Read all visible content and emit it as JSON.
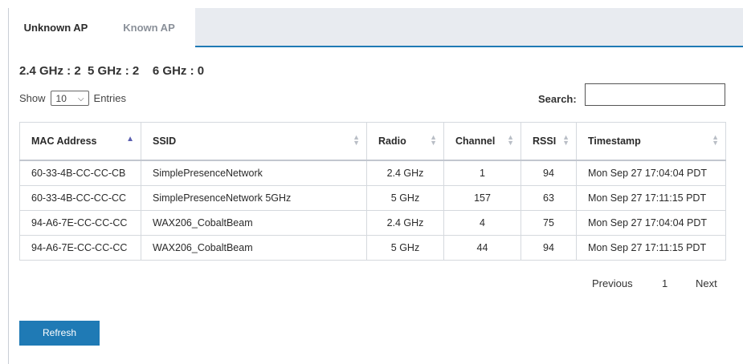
{
  "tabs": [
    {
      "label": "Unknown AP",
      "active": true
    },
    {
      "label": "Known AP",
      "active": false
    }
  ],
  "counts": {
    "g24": "2.4 GHz : 2",
    "g5": "5 GHz : 2",
    "g6": "6 GHz : 0"
  },
  "length_menu": {
    "show_label": "Show",
    "selected": "10",
    "entries_label": "Entries"
  },
  "search": {
    "label": "Search:",
    "value": ""
  },
  "table": {
    "columns": [
      "MAC Address",
      "SSID",
      "Radio",
      "Channel",
      "RSSI",
      "Timestamp"
    ],
    "rows": [
      [
        "60-33-4B-CC-CC-CB",
        "SimplePresenceNetwork",
        "2.4 GHz",
        "1",
        "94",
        "Mon Sep 27 17:04:04 PDT"
      ],
      [
        "60-33-4B-CC-CC-CC",
        "SimplePresenceNetwork 5GHz",
        "5 GHz",
        "157",
        "63",
        "Mon Sep 27 17:11:15 PDT"
      ],
      [
        "94-A6-7E-CC-CC-CC",
        "WAX206_CobaltBeam",
        "2.4 GHz",
        "4",
        "75",
        "Mon Sep 27 17:04:04 PDT"
      ],
      [
        "94-A6-7E-CC-CC-CC",
        "WAX206_CobaltBeam",
        "5 GHz",
        "44",
        "94",
        "Mon Sep 27 17:11:15 PDT"
      ]
    ]
  },
  "pagination": {
    "previous": "Previous",
    "current": "1",
    "next": "Next"
  },
  "refresh_label": "Refresh",
  "colors": {
    "accent": "#1f7ab5",
    "sort_active": "#5b5fb0"
  }
}
